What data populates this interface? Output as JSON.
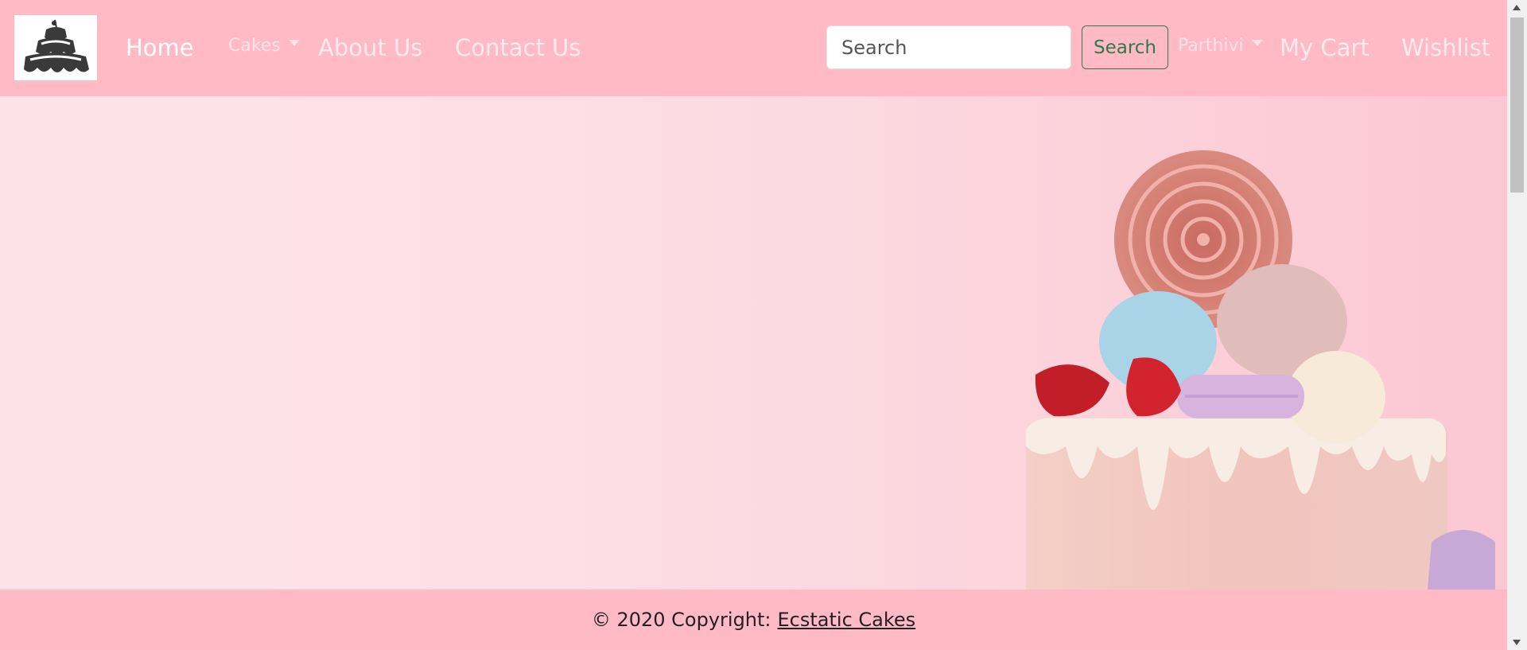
{
  "navbar": {
    "logo_icon": "tiered-cake-logo-icon",
    "home": "Home",
    "cakes": "Cakes",
    "about": "About Us",
    "contact": "Contact Us",
    "search_placeholder": "Search",
    "search_button": "Search",
    "user": "Parthivi",
    "cart": "My Cart",
    "wishlist": "Wishlist"
  },
  "hero": {
    "image": "pink drip cake with macarons, lollipop and strawberries"
  },
  "footer": {
    "copyright": "© 2020 Copyright:",
    "brand_link": "Ecstatic Cakes"
  },
  "colors": {
    "navbar_bg": "#ffbac6",
    "hero_bg": "#fde0e6",
    "search_accent": "#2f7a4b"
  }
}
